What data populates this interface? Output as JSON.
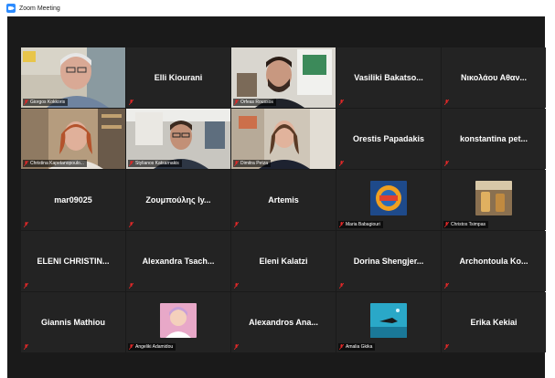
{
  "window": {
    "title": "Zoom Meeting"
  },
  "colors": {
    "tile_bg": "#232323",
    "stage_bg": "#1a1a1a",
    "active_speaker": "#a7d04a",
    "mic_muted": "#e02828"
  },
  "participants": [
    {
      "name": "Giorgos Kokkoris",
      "type": "video",
      "active": true
    },
    {
      "name": "Elli Kiourani",
      "type": "name"
    },
    {
      "name": "Orfeas Roussos",
      "type": "video"
    },
    {
      "name": "Vasiliki  Bakatso...",
      "type": "name"
    },
    {
      "name": "Νικολάου Αθαν...",
      "type": "name"
    },
    {
      "name": "Christina Kapetanopoulo...",
      "type": "video"
    },
    {
      "name": "Stylianos Katsarnakis",
      "type": "video"
    },
    {
      "name": "Dimitra Petza",
      "type": "video"
    },
    {
      "name": "Orestis Papadakis",
      "type": "name"
    },
    {
      "name": "konstantina pet...",
      "type": "name"
    },
    {
      "name": "mar09025",
      "type": "name"
    },
    {
      "name": "Ζουμπούλης Iy...",
      "type": "name"
    },
    {
      "name": "Artemis",
      "type": "name"
    },
    {
      "name": "Maria Babagiouri",
      "type": "picture"
    },
    {
      "name": "Christos Tsimpas",
      "type": "picture"
    },
    {
      "name": "ELENI  CHRISTIN...",
      "type": "name"
    },
    {
      "name": "Alexandra  Tsach...",
      "type": "name"
    },
    {
      "name": "Eleni Kalatzi",
      "type": "name"
    },
    {
      "name": "Dorina  Shengjer...",
      "type": "name"
    },
    {
      "name": "Archontoula  Ko...",
      "type": "name"
    },
    {
      "name": "Giannis Mathiou",
      "type": "name"
    },
    {
      "name": "Angeliki Adamidou",
      "type": "picture"
    },
    {
      "name": "Alexandros  Ana...",
      "type": "name"
    },
    {
      "name": "Amalia Gkika",
      "type": "picture"
    },
    {
      "name": "Erika Kekiai",
      "type": "name"
    }
  ]
}
